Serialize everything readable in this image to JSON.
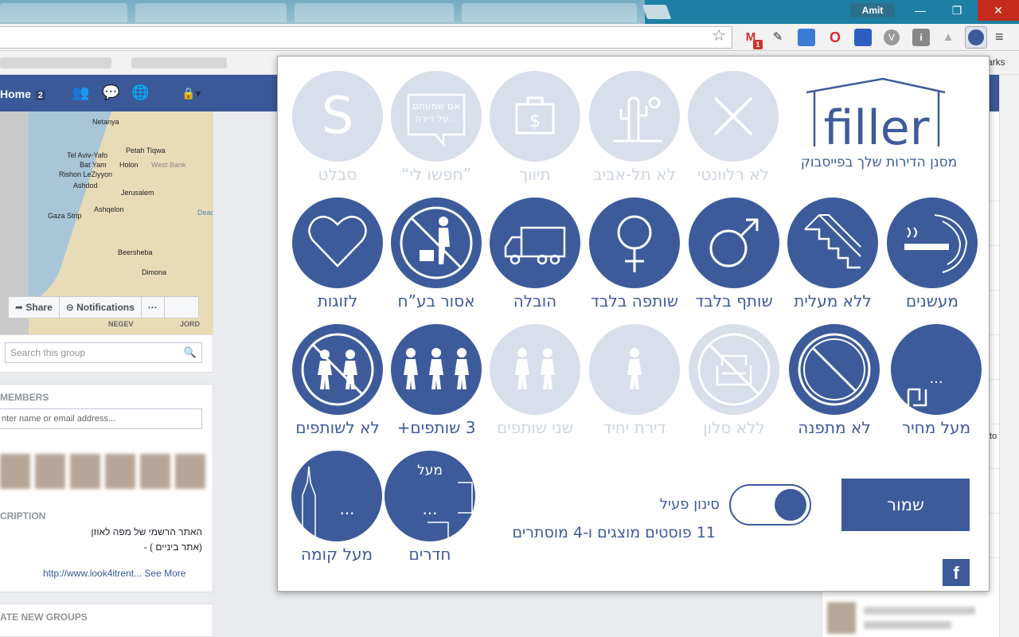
{
  "browser": {
    "user_name": "Amit",
    "window_buttons": {
      "minimize": "—",
      "maximize": "❐",
      "close": "✕"
    },
    "bookmark_right_text": "arks",
    "gmail_badge": "1",
    "extension_labels": {
      "opera": "O",
      "vbtn": "V",
      "info": "i"
    }
  },
  "facebook": {
    "home_label": "Home",
    "home_count": "2",
    "map_cities": [
      "Netanya",
      "Tel Aviv-Yafo",
      "Petah Tiqwa",
      "Bat Yam",
      "Holon",
      "Rishon LeZiyyon",
      "Ashdod",
      "Jerusalem",
      "Ashqelon",
      "Gaza Strip",
      "Beersheba",
      "Dimona",
      "NEGEV",
      "JORD",
      "West Bank",
      "Dead Sea"
    ],
    "share_label": "Share",
    "notifications_label": "Notifications",
    "more_label": "···",
    "search_placeholder": "Search this group",
    "members_title": "MEMBERS",
    "members_placeholder": "nter name or email address...",
    "description_title": "CRIPTION",
    "description_line1": "האתר הרשמי של מפה לאוזן",
    "description_line2": "(אתר ביניים ) -",
    "description_link": "http://www.look4itrent...",
    "see_more": "See More",
    "create_groups_title": "ATE NEW GROUPS",
    "right_col_text": "to"
  },
  "filler": {
    "logo_text": "filler",
    "tagline": "מסנן הדירות שלך בפייסבוק",
    "row1": [
      {
        "label": "לא רלוונטי",
        "icon": "x-icon"
      },
      {
        "label": "לא תל-אביב",
        "icon": "cactus-icon"
      },
      {
        "label": "תיווך",
        "icon": "briefcase-dollar-icon"
      },
      {
        "label": "”חפשו לי“",
        "icon": "speech-bubble-icon",
        "bubble_line1": "אם שמעתם",
        "bubble_line2": "על דירה..."
      },
      {
        "label": "סבלט",
        "icon": "s-letter-icon",
        "letter": "S"
      }
    ],
    "row2": [
      {
        "label": "מעשנים",
        "icon": "smoking-icon"
      },
      {
        "label": "ללא מעלית",
        "icon": "stairs-icon"
      },
      {
        "label": "שותף בלבד",
        "icon": "male-icon"
      },
      {
        "label": "שותפה בלבד",
        "icon": "female-icon"
      },
      {
        "label": "הובלה",
        "icon": "truck-icon"
      },
      {
        "label": "אסור בע”ח",
        "icon": "no-pets-icon"
      },
      {
        "label": "לזוגות",
        "icon": "heart-icon"
      }
    ],
    "row3": [
      {
        "label": "מעל מחיר",
        "icon": "shekel-price-icon",
        "dots": "..."
      },
      {
        "label": "לא מתפנה",
        "icon": "prohibited-icon"
      },
      {
        "label": "ללא סלון",
        "icon": "no-armchair-icon"
      },
      {
        "label": "דירת יחיד",
        "icon": "single-person-icon"
      },
      {
        "label": "שני שותפים",
        "icon": "two-people-icon"
      },
      {
        "label": "3 שותפים+",
        "icon": "three-people-icon"
      },
      {
        "label": "לא לשותפים",
        "icon": "no-roommates-icon"
      }
    ],
    "row4": [
      {
        "label": "חדרים",
        "icon": "rooms-icon",
        "top_text": "מעל",
        "dots": "..."
      },
      {
        "label": "מעל קומה",
        "icon": "building-icon",
        "dots": "..."
      }
    ],
    "save_label": "שמור",
    "toggle_label": "סינון פעיל",
    "toggle_on": true,
    "status_text": "11 פוסטים מוצגים ו-4 מוסתרים",
    "facebook_button": "f",
    "accent_color": "#3d5b9b",
    "inactive_color": "#d8deea"
  }
}
